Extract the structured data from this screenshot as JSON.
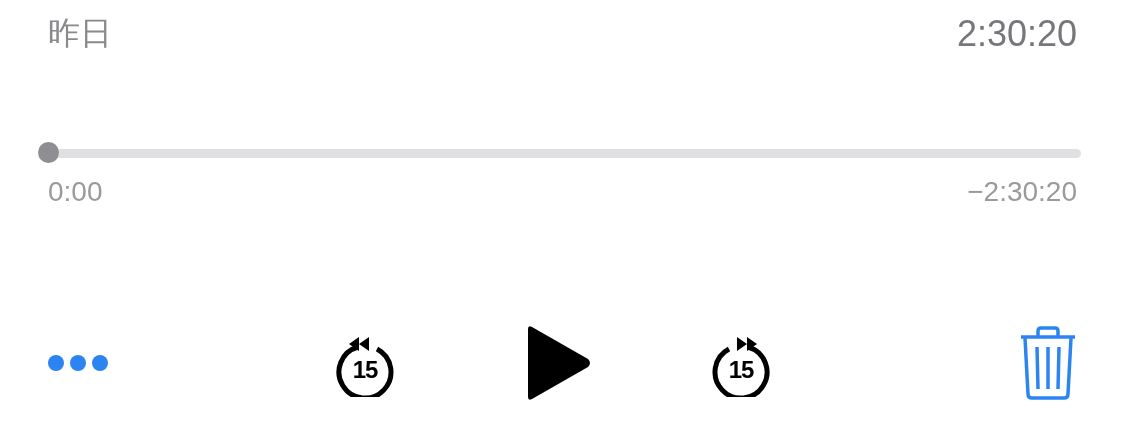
{
  "recording": {
    "date": "昨日",
    "duration": "2:30:20"
  },
  "scrubber": {
    "level": 0,
    "elapsed": "0:00",
    "remaining": "−2:30:20"
  },
  "controls": {
    "skip_back": "15",
    "skip_forward": "15"
  }
}
